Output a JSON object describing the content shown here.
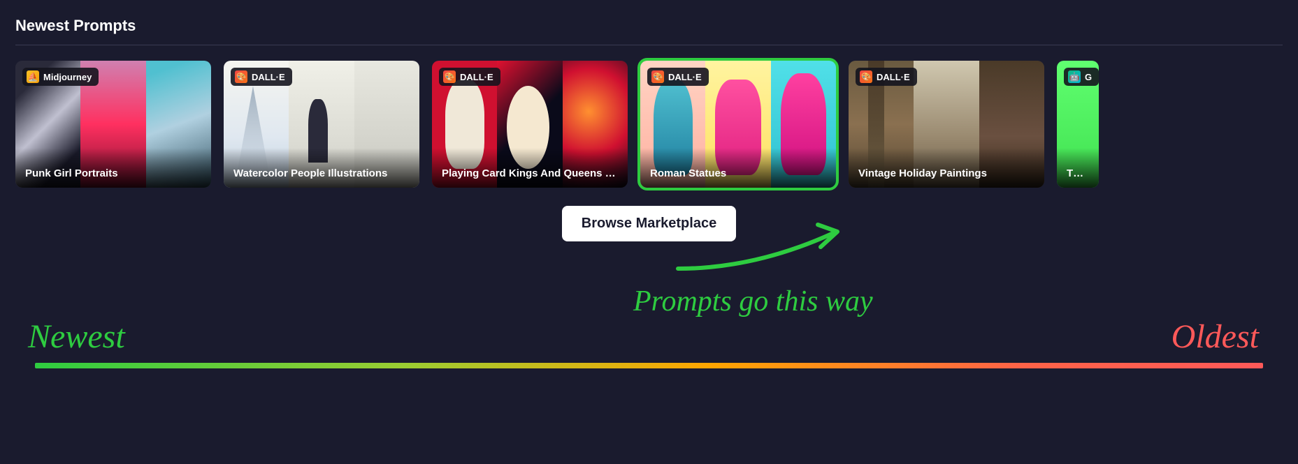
{
  "section_title": "Newest Prompts",
  "cards": [
    {
      "engine": "Midjourney",
      "engine_icon": "midjourney",
      "title": "Punk Girl Portraits",
      "highlighted": false
    },
    {
      "engine": "DALL·E",
      "engine_icon": "dalle",
      "title": "Watercolor People Illustrations",
      "highlighted": false
    },
    {
      "engine": "DALL·E",
      "engine_icon": "dalle",
      "title": "Playing Card Kings And Queens - P…",
      "highlighted": false
    },
    {
      "engine": "DALL·E",
      "engine_icon": "dalle",
      "title": "Roman Statues",
      "highlighted": true
    },
    {
      "engine": "DALL·E",
      "engine_icon": "dalle",
      "title": "Vintage Holiday Paintings",
      "highlighted": false
    },
    {
      "engine": "G",
      "engine_icon": "gpt",
      "title": "The Pr",
      "highlighted": false
    }
  ],
  "browse_button": "Browse Marketplace",
  "annotation": {
    "arrow_text": "Prompts go this way",
    "newest": "Newest",
    "oldest": "Oldest"
  },
  "colors": {
    "highlight": "#2ecc40",
    "oldest": "#ff5959",
    "bg": "#1a1b2e"
  }
}
